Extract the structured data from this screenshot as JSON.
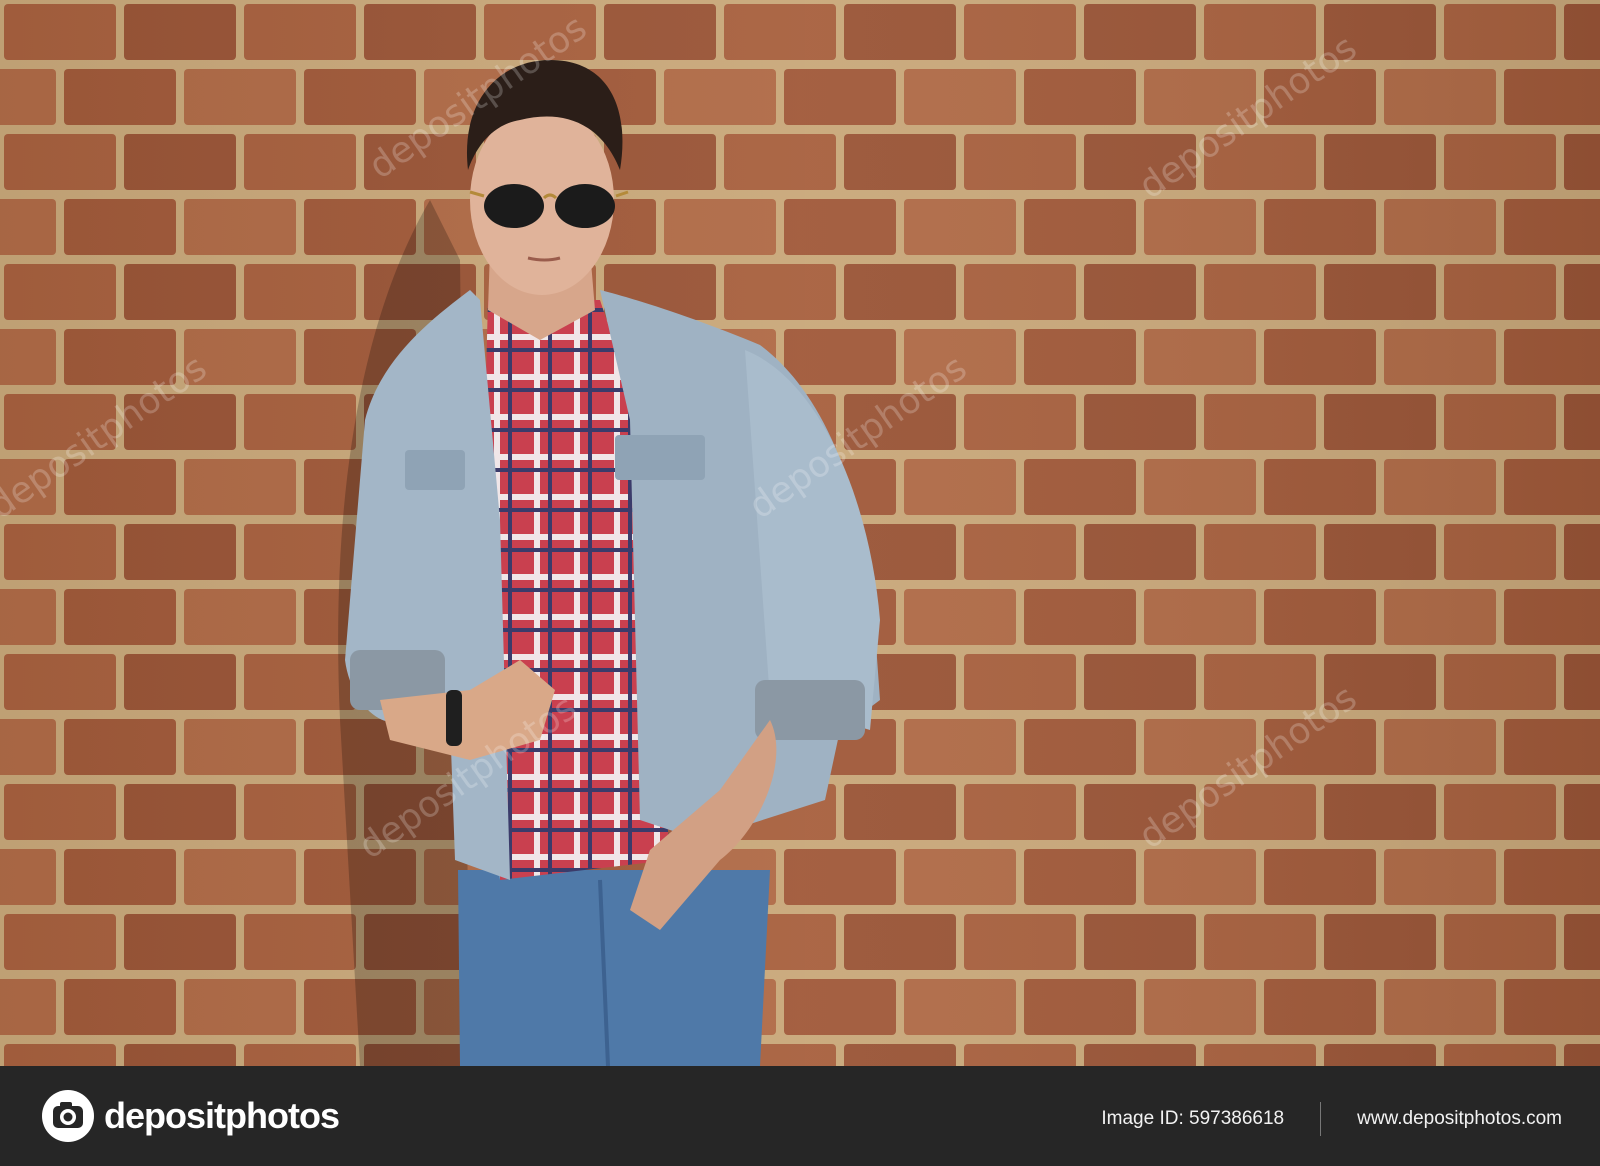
{
  "photo": {
    "subject": "man-in-denim-jacket-against-brick-wall",
    "watermark_text": "depositphotos"
  },
  "footer": {
    "brand": "depositphotos",
    "image_id_label": "Image ID: 597386618",
    "website": "www.depositphotos.com"
  },
  "colors": {
    "footer_bg": "#262626",
    "mortar": "#c9a87a",
    "brick": "#a8613f",
    "denim_jacket": "#9fb2c3",
    "jeans": "#4f79a8"
  }
}
